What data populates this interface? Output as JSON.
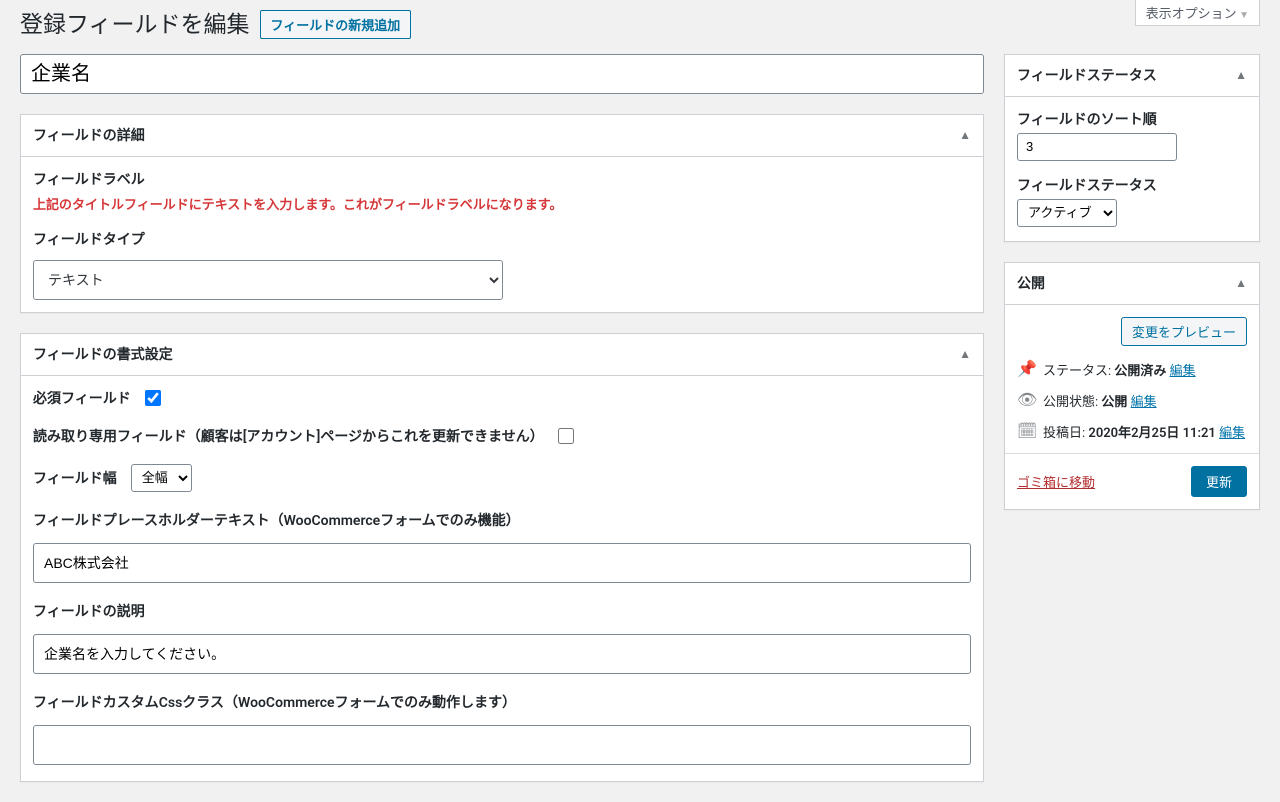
{
  "screen_options": "表示オプション",
  "header": {
    "title": "登録フィールドを編集",
    "add_new": "フィールドの新規追加"
  },
  "title_value": "企業名",
  "panels": {
    "field_details": {
      "heading": "フィールドの詳細",
      "label_heading": "フィールドラベル",
      "label_notice": "上記のタイトルフィールドにテキストを入力します。これがフィールドラベルになります。",
      "type_label": "フィールドタイプ",
      "type_value": "テキスト"
    },
    "field_format": {
      "heading": "フィールドの書式設定",
      "required_label": "必須フィールド",
      "readonly_label": "読み取り専用フィールド（顧客は[アカウント]ページからこれを更新できません）",
      "width_label": "フィールド幅",
      "width_value": "全幅",
      "placeholder_label": "フィールドプレースホルダーテキスト（WooCommerceフォームでのみ機能）",
      "placeholder_value": "ABC株式会社",
      "description_label": "フィールドの説明",
      "description_value": "企業名を入力してください。",
      "css_label": "フィールドカスタムCssクラス（WooCommerceフォームでのみ動作します）",
      "css_value": ""
    }
  },
  "sidebar": {
    "status": {
      "heading": "フィールドステータス",
      "sort_label": "フィールドのソート順",
      "sort_value": "3",
      "status_label": "フィールドステータス",
      "status_value": "アクティブ"
    },
    "publish": {
      "heading": "公開",
      "preview_btn": "変更をプレビュー",
      "status_label": "ステータス:",
      "status_value": "公開済み",
      "visibility_label": "公開状態:",
      "visibility_value": "公開",
      "date_label": "投稿日:",
      "date_value": "2020年2月25日 11:21",
      "edit_link": "編集",
      "trash_link": "ゴミ箱に移動",
      "update_btn": "更新"
    }
  }
}
